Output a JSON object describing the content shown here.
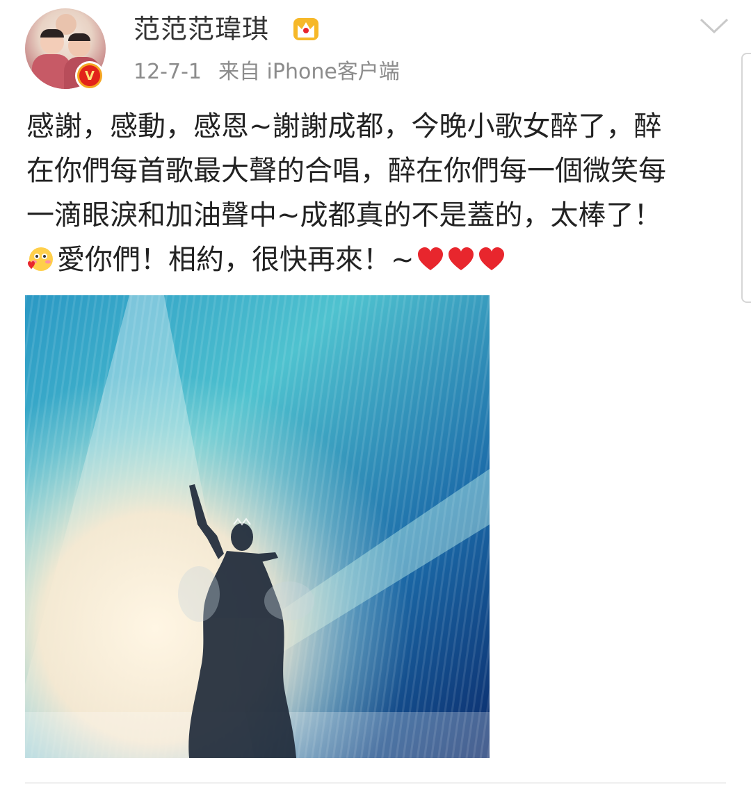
{
  "post": {
    "user_name": "范范范瑋琪",
    "date": "12-7-1",
    "source": "来自 iPhone客户端",
    "text_lines": [
      "感謝，感動，感恩~謝謝成都，今晚小歌女醉了，醉",
      "在你們每首歌最大聲的合唱，醉在你們每一個微笑每",
      "一滴眼淚和加油聲中~成都真的不是蓋的，太棒了！",
      "愛你們！相約，很快再來！~"
    ],
    "emoji_names": [
      "blush-face-icon",
      "heart-icon",
      "heart-icon",
      "heart-icon"
    ],
    "verified_mark": "V"
  },
  "colors": {
    "text": "#222222",
    "meta": "#8c8c8c",
    "verified_orange": "#f5a623",
    "verified_red": "#e2231a",
    "heart_red": "#e8262d",
    "stage_blue": "#1e6fa8"
  }
}
